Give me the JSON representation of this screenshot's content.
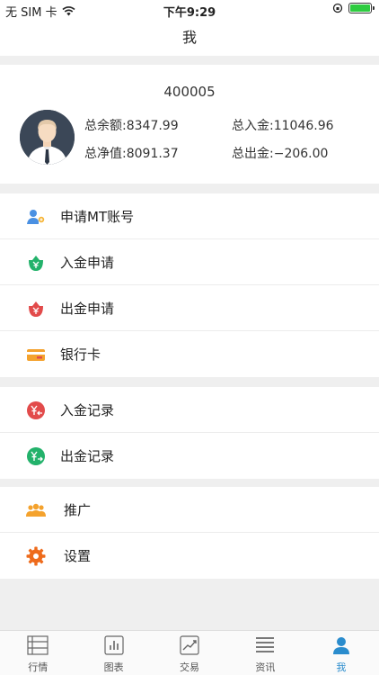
{
  "status_bar": {
    "carrier": "无 SIM 卡",
    "time": "下午9:29"
  },
  "nav": {
    "title": "我"
  },
  "profile": {
    "account_number": "400005",
    "balance_label": "总余额:8347.99",
    "deposit_total_label": "总入金:11046.96",
    "equity_label": "总净值:8091.37",
    "withdraw_total_label": "总出金:−206.00"
  },
  "menu": {
    "apply_mt": "申请MT账号",
    "deposit_apply": "入金申请",
    "withdraw_apply": "出金申请",
    "bank_card": "银行卡",
    "deposit_records": "入金记录",
    "withdraw_records": "出金记录",
    "promote": "推广",
    "settings": "设置"
  },
  "tabs": {
    "quotes": "行情",
    "charts": "图表",
    "trade": "交易",
    "news": "资讯",
    "me": "我"
  },
  "colors": {
    "accent": "#2a8ccd",
    "green": "#23b26b",
    "red": "#e24b4b",
    "orange": "#f4a22d",
    "settings_orange": "#ee6b1c",
    "battery": "#2ecc40"
  }
}
